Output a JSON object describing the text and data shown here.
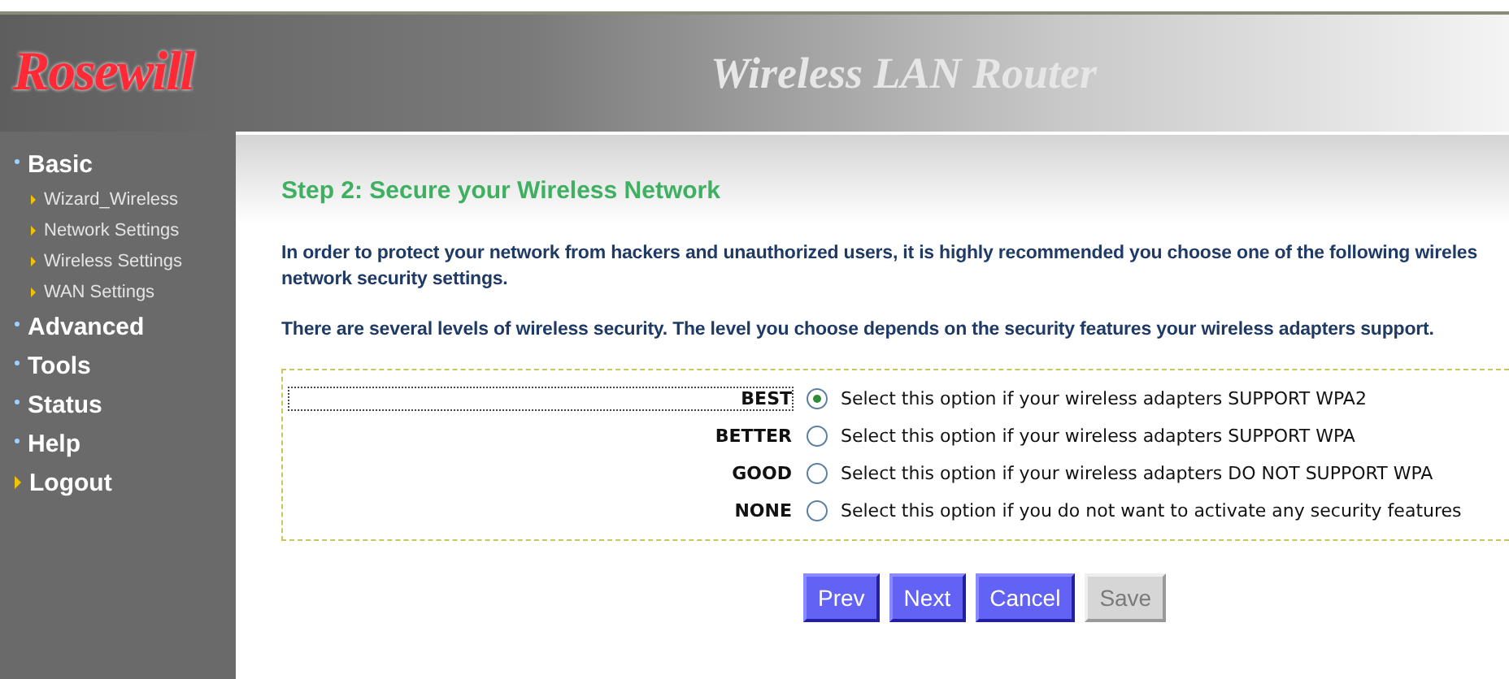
{
  "header": {
    "logo": "Rosewill",
    "title": "Wireless LAN Router"
  },
  "sidebar": {
    "items": [
      {
        "label": "Basic",
        "kind": "section",
        "children": [
          {
            "label": "Wizard_Wireless"
          },
          {
            "label": "Network Settings"
          },
          {
            "label": "Wireless Settings"
          },
          {
            "label": "WAN Settings"
          }
        ]
      },
      {
        "label": "Advanced",
        "kind": "section"
      },
      {
        "label": "Tools",
        "kind": "section"
      },
      {
        "label": "Status",
        "kind": "section"
      },
      {
        "label": "Help",
        "kind": "section"
      },
      {
        "label": "Logout",
        "kind": "action"
      }
    ]
  },
  "content": {
    "heading": "Step 2: Secure your Wireless Network",
    "intro_lines": [
      "In order to protect your network from hackers and unauthorized users, it is highly recommended you choose one of the following wireles",
      "network security settings."
    ],
    "levels_note": "There are several levels of wireless security. The level you choose depends on the security features your wireless adapters support.",
    "options": [
      {
        "level_name": "BEST",
        "description": "Select this option if your wireless adapters SUPPORT WPA2",
        "selected": true
      },
      {
        "level_name": "BETTER",
        "description": "Select this option if your wireless adapters SUPPORT WPA",
        "selected": false
      },
      {
        "level_name": "GOOD",
        "description": "Select this option if your wireless adapters DO NOT SUPPORT WPA",
        "selected": false
      },
      {
        "level_name": "NONE",
        "description": "Select this option if you do not want to activate any security features",
        "selected": false
      }
    ],
    "buttons": [
      {
        "label": "Prev",
        "disabled": false
      },
      {
        "label": "Next",
        "disabled": false
      },
      {
        "label": "Cancel",
        "disabled": false
      },
      {
        "label": "Save",
        "disabled": true
      }
    ]
  }
}
